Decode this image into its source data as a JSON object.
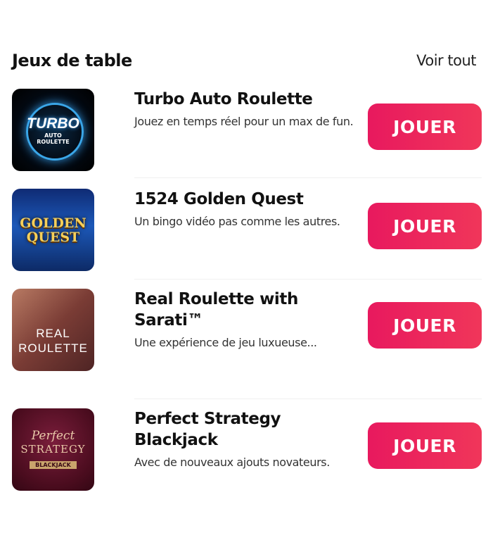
{
  "section": {
    "title": "Jeux de table",
    "see_all": "Voir tout"
  },
  "games": [
    {
      "name": "Turbo Auto Roulette",
      "description": "Jouez en temps réel pour un max de fun.",
      "button": "JOUER",
      "thumb": {
        "line1": "TURBO",
        "line2": "AUTO",
        "line3": "ROULETTE"
      }
    },
    {
      "name": "1524 Golden Quest",
      "description": "Un bingo vidéo pas comme les autres.",
      "button": "JOUER",
      "thumb": {
        "line1": "GOLDEN",
        "line2": "QUEST"
      }
    },
    {
      "name": "Real Roulette with Sarati™",
      "description": "Une expérience de jeu luxueuse...",
      "button": "JOUER",
      "thumb": {
        "line1": "REAL",
        "line2": "ROULETTE"
      }
    },
    {
      "name": "Perfect Strategy Blackjack",
      "description": "Avec de nouveaux ajouts novateurs.",
      "button": "JOUER",
      "thumb": {
        "line1": "Perfect",
        "line2": "STRATEGY",
        "line3": "BLACKJACK"
      }
    }
  ],
  "colors": {
    "accent": "#e8195e",
    "text": "#111111"
  }
}
